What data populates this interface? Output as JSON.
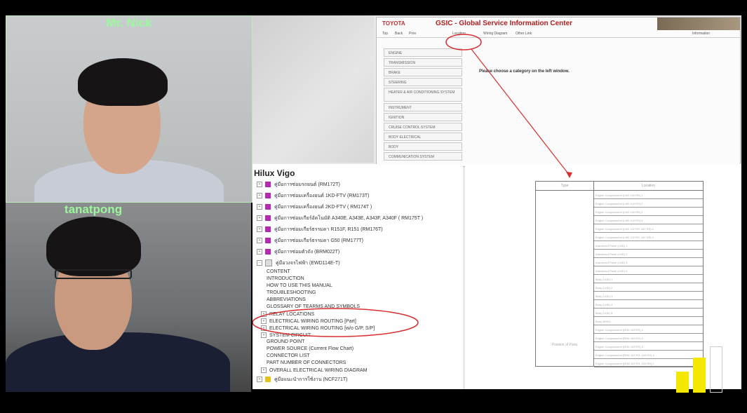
{
  "participants": [
    {
      "name": "Mr. Nick"
    },
    {
      "name": "tanatpong"
    }
  ],
  "browser": {
    "brand": "TOYOTA",
    "title": "GSIC - Global Service Information Center",
    "nav": [
      "Top",
      "Back",
      "Prev",
      "Location",
      "Wiring Diagram",
      "Other Link",
      "Information"
    ],
    "side_menu": [
      "ENGINE",
      "TRANSMISSION",
      "BRAKE",
      "STEERING",
      "HEATER & AIR CONDITIONING SYSTEM",
      "INSTRUMENT",
      "IGNITION",
      "CRUISE CONTROL SYSTEM",
      "BODY ELECTRICAL",
      "BODY",
      "COMMUNICATION SYSTEM"
    ],
    "prompt": "Please choose a category on the left window."
  },
  "tree": {
    "title": "Hilux Vigo",
    "books": [
      {
        "label": "คู่มือการซ่อมรถยนต์ (RM172T)",
        "color": "#b22ab2"
      },
      {
        "label": "คู่มือการซ่อมเครื่องยนต์ 1KD-FTV (RM173T)",
        "color": "#b22ab2"
      },
      {
        "label": "คู่มือการซ่อมเครื่องยนต์ 2KD-FTV ( RM174T )",
        "color": "#b22ab2"
      },
      {
        "label": "คู่มือการซ่อมเกียร์อัตโนมัติ A340E, A343E, A343F, A340F ( RM175T )",
        "color": "#b22ab2"
      },
      {
        "label": "คู่มือการซ่อมเกียร์ธรรมดา R151F, R151 (RM176T)",
        "color": "#b22ab2"
      },
      {
        "label": "คู่มือการซ่อมเกียร์ธรรมดา G50 (RM177T)",
        "color": "#b22ab2"
      },
      {
        "label": "คู่มือการซ่อมตัวถัง (BRM022T)",
        "color": "#b22ab2"
      },
      {
        "label": "คู่มือวงจรไฟฟ้า (EWD114E-T)",
        "color": "#dddddd"
      }
    ],
    "ewd_items": [
      {
        "label": "CONTENT",
        "expandable": false
      },
      {
        "label": "INTRODUCTION",
        "expandable": false
      },
      {
        "label": "HOW TO USE THIS MANUAL",
        "expandable": false
      },
      {
        "label": "TROUBLESHOOTING",
        "expandable": false
      },
      {
        "label": "ABBREVIATIONS",
        "expandable": false
      },
      {
        "label": "GLOSSARY OF TEARMS AND SYMBOLS",
        "expandable": false
      },
      {
        "label": "RELAY LOCATIONS",
        "expandable": true
      },
      {
        "label": "ELECTRICAL WIRING ROUTING [Part]",
        "expandable": true
      },
      {
        "label": "ELECTRICAL WIRING ROUTING [w/o G/P, S/P]",
        "expandable": true
      },
      {
        "label": "SYSTEM CIRCUIT",
        "expandable": true
      },
      {
        "label": "GROUND POINT",
        "expandable": false
      },
      {
        "label": "POWER SOURCE (Current Flow Chart)",
        "expandable": false
      },
      {
        "label": "CONNECTOR LIST",
        "expandable": false
      },
      {
        "label": "PART NUMBER OF CONNECTORS",
        "expandable": false
      },
      {
        "label": "OVERALL ELECTRICAL WIRING DIAGRAM",
        "expandable": true
      }
    ],
    "last_book": {
      "label": "คู่มือแนะนำการใช้งาน (NCF271T)",
      "color": "#e8c020"
    }
  },
  "location_table": {
    "headers": [
      "Type",
      "Location"
    ],
    "first_col_label": "Position of Parts",
    "rows": [
      "Engine Compartment (LHD 109 RS) 1",
      "Engine Compartment (LHD 109 RS) 2",
      "Engine Compartment (LHD 109 RS) 3",
      "Engine Compartment (LHD 109 RS) 4",
      "Engine Compartment (LHD 122 RS, 167 RS) 1",
      "Engine Compartment (LHD 122 RS, 167 RS) 2",
      "Instrument Panel (LHD) 1",
      "Instrument Panel (LHD) 2",
      "Instrument Panel (LHD) 3",
      "Instrument Panel (LHD) 4",
      "Body (LHD) 1",
      "Body (LHD) 2",
      "Body (LHD) 3",
      "Body (LHD) 4",
      "Body (LHD) 5",
      "Body (RHD)",
      "Engine Compartment (RHD 109 RS) 1",
      "Engine Compartment (RHD 109 RS) 2",
      "Engine Compartment (RHD 109 RS) 3",
      "Engine Compartment (RHD 122 RS, 109 RS) 1",
      "Engine Compartment (RHD 122 RS, 109 RS) 2"
    ]
  },
  "audio_meter": {
    "levels": [
      0.45,
      0.75,
      0.0
    ]
  },
  "colors": {
    "annotation": "#d83030",
    "cam_label": "#9cf79c"
  }
}
